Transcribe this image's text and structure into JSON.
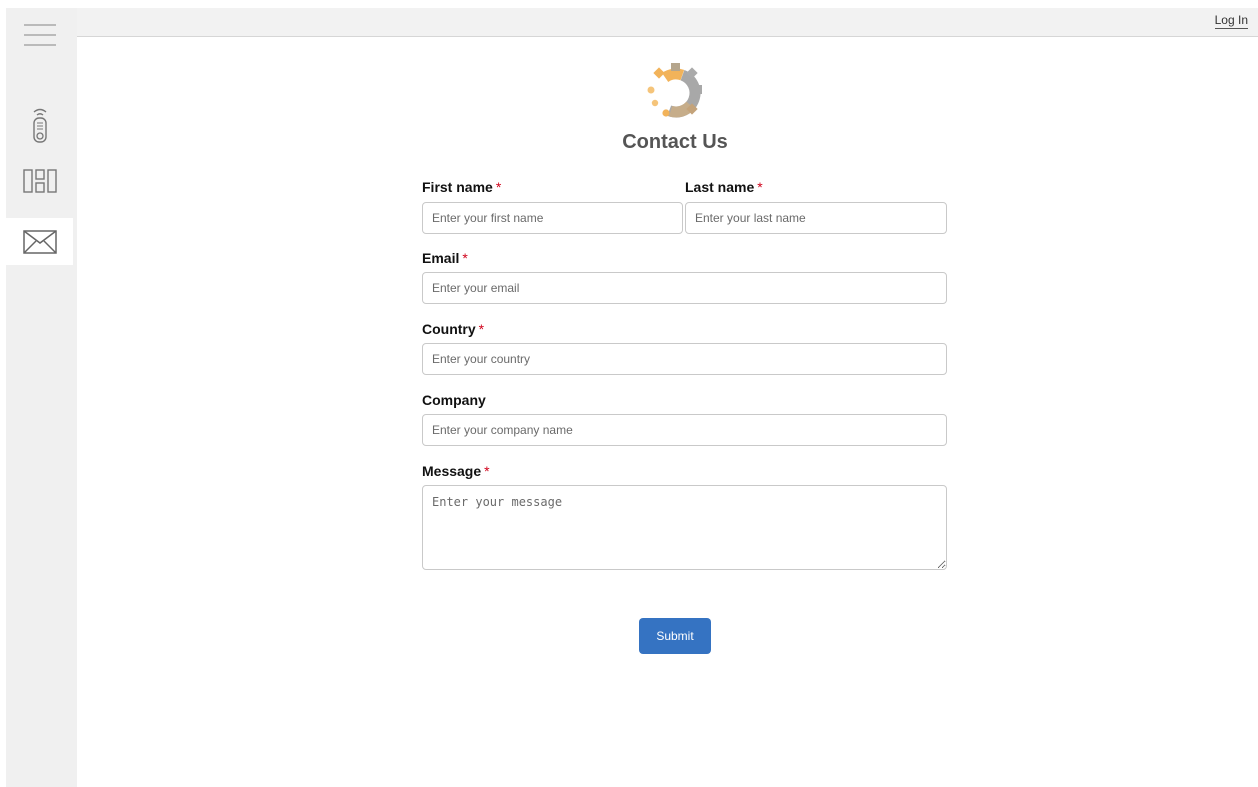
{
  "header": {
    "login_label": "Log In"
  },
  "sidebar": {
    "items": [
      {
        "icon": "hamburger-menu-icon"
      },
      {
        "icon": "remote-control-icon"
      },
      {
        "icon": "layout-grid-icon"
      },
      {
        "icon": "mail-icon",
        "active": true
      }
    ]
  },
  "logo": {
    "icon": "gear-logo-icon",
    "colors": [
      "#f2b35a",
      "#a8a8a8"
    ]
  },
  "form": {
    "title": "Contact Us",
    "required_marker": "*",
    "first_name": {
      "label": "First name",
      "placeholder": "Enter your first name",
      "value": ""
    },
    "last_name": {
      "label": "Last name",
      "placeholder": "Enter your last name",
      "value": ""
    },
    "email": {
      "label": "Email",
      "placeholder": "Enter your email",
      "value": ""
    },
    "country": {
      "label": "Country",
      "placeholder": "Enter your country",
      "value": ""
    },
    "company": {
      "label": "Company",
      "placeholder": "Enter your company name",
      "value": ""
    },
    "message": {
      "label": "Message",
      "placeholder": "Enter your message",
      "value": ""
    },
    "submit_label": "Submit"
  },
  "colors": {
    "accent": "#3573c2",
    "required": "#d0021b",
    "sidebar_bg": "#f0f0f0"
  }
}
